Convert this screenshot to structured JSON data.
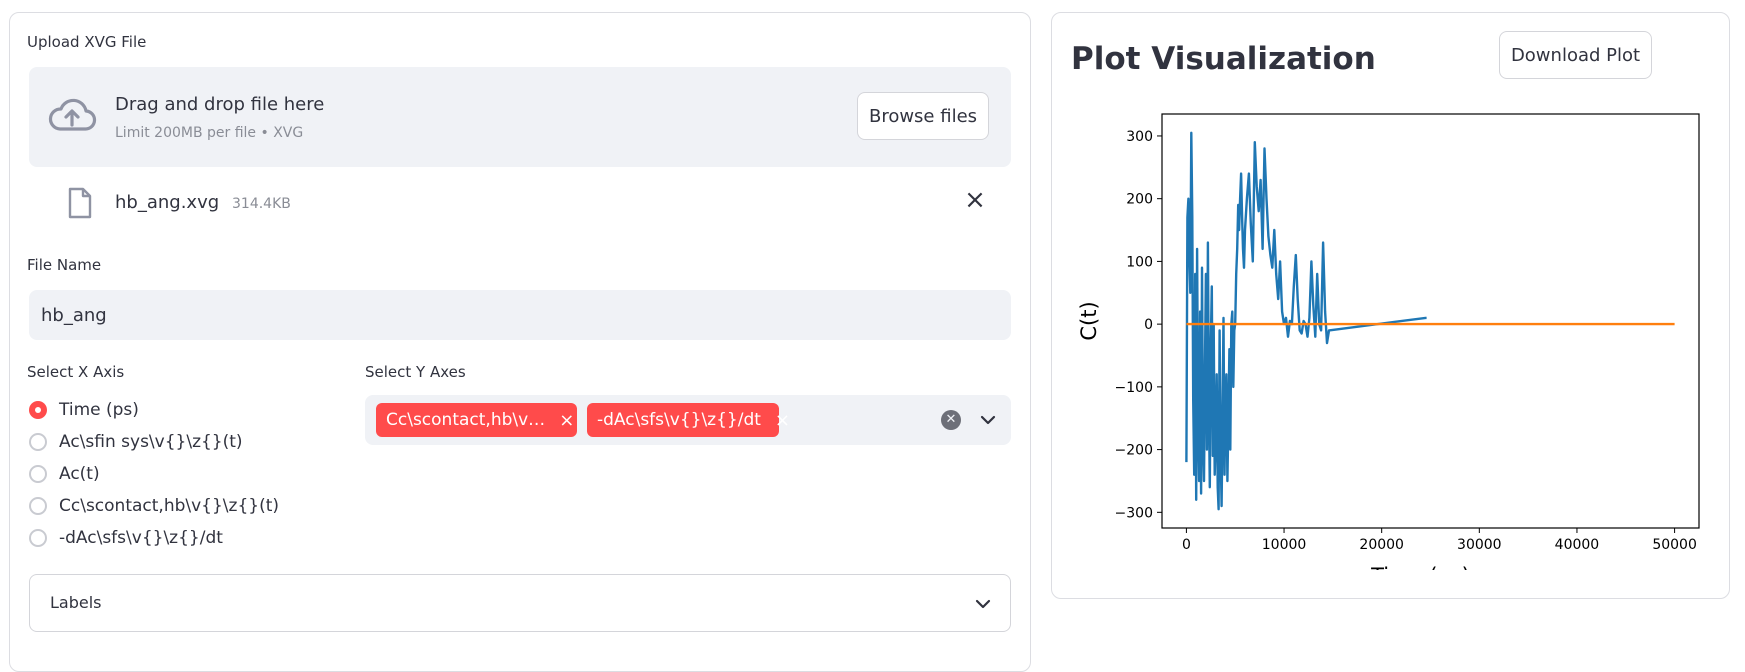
{
  "upload": {
    "label": "Upload XVG File",
    "drop_title": "Drag and drop file here",
    "drop_subtitle": "Limit 200MB per file • XVG",
    "browse_label": "Browse files",
    "icon": "cloud-upload-icon"
  },
  "uploaded_file": {
    "name": "hb_ang.xvg",
    "size": "314.4KB",
    "icon": "file-icon",
    "remove_icon": "close-icon"
  },
  "file_name": {
    "label": "File Name",
    "value": "hb_ang"
  },
  "x_axis": {
    "label": "Select X Axis",
    "options": [
      "Time (ps)",
      "Ac\\sfin sys\\v{}\\z{}(t)",
      "Ac(t)",
      "Cc\\scontact,hb\\v{}\\z{}(t)",
      "-dAc\\sfs\\v{}\\z{}/dt"
    ],
    "selected": "Time (ps)"
  },
  "y_axes": {
    "label": "Select Y Axes",
    "chips": [
      "Cc\\scontact,hb\\v…",
      "-dAc\\sfs\\v{}\\z{}/dt"
    ]
  },
  "labels_expander": {
    "label": "Labels"
  },
  "plot": {
    "title": "Plot Visualization",
    "download_label": "Download Plot"
  },
  "colors": {
    "accent": "#ff4b4b",
    "series_blue": "#1f77b4",
    "series_orange": "#ff7f0e",
    "input_bg": "#f0f2f6"
  },
  "chart_data": {
    "type": "line",
    "xlabel": "Time (ps)",
    "ylabel": "C(t)",
    "xlim": [
      -2500,
      52500
    ],
    "ylim": [
      -325,
      335
    ],
    "xticks": [
      0,
      10000,
      20000,
      30000,
      40000,
      50000
    ],
    "yticks": [
      -300,
      -200,
      -100,
      0,
      100,
      200,
      300
    ],
    "grid": false,
    "series": [
      {
        "color": "#1f77b4",
        "x": [
          0,
          100,
          200,
          300,
          400,
          500,
          600,
          700,
          800,
          900,
          1000,
          1100,
          1200,
          1300,
          1400,
          1500,
          1600,
          1700,
          1800,
          1900,
          2000,
          2100,
          2200,
          2300,
          2400,
          2500,
          2600,
          2700,
          2800,
          2900,
          3000,
          3100,
          3200,
          3300,
          3400,
          3500,
          3600,
          3700,
          3800,
          3900,
          4000,
          4100,
          4200,
          4300,
          4400,
          4500,
          4600,
          4700,
          4800,
          4900,
          5000,
          5100,
          5200,
          5300,
          5400,
          5500,
          5600,
          5700,
          5800,
          5900,
          6000,
          6200,
          6400,
          6600,
          6800,
          7000,
          7200,
          7400,
          7600,
          7800,
          8000,
          8200,
          8400,
          8600,
          8800,
          9000,
          9200,
          9400,
          9600,
          9800,
          10000,
          10200,
          10400,
          10600,
          10800,
          11000,
          11200,
          11400,
          11600,
          11800,
          12000,
          12200,
          12400,
          12600,
          12800,
          13000,
          13200,
          13400,
          13600,
          13800,
          14000,
          14200,
          14400,
          14600,
          24500,
          24600
        ],
        "y": [
          -220,
          170,
          200,
          110,
          50,
          305,
          170,
          -120,
          -240,
          80,
          -280,
          120,
          -160,
          -250,
          20,
          -270,
          90,
          -180,
          -250,
          -60,
          80,
          -200,
          130,
          -130,
          -260,
          -30,
          60,
          -210,
          0,
          -240,
          -180,
          -80,
          -260,
          -295,
          -10,
          -200,
          -290,
          -150,
          10,
          -240,
          -120,
          -80,
          -250,
          -150,
          -40,
          -200,
          0,
          20,
          -100,
          -10,
          0,
          80,
          120,
          190,
          150,
          200,
          240,
          170,
          120,
          90,
          150,
          200,
          240,
          160,
          100,
          290,
          220,
          180,
          230,
          120,
          280,
          200,
          140,
          110,
          90,
          150,
          80,
          40,
          100,
          20,
          0,
          10,
          -20,
          5,
          0,
          60,
          110,
          40,
          -10,
          -15,
          5,
          0,
          -20,
          10,
          100,
          30,
          -20,
          80,
          0,
          -10,
          130,
          20,
          -30,
          -10,
          10,
          10
        ]
      },
      {
        "color": "#ff7f0e",
        "x": [
          0,
          50000
        ],
        "y": [
          0,
          0
        ]
      }
    ]
  }
}
